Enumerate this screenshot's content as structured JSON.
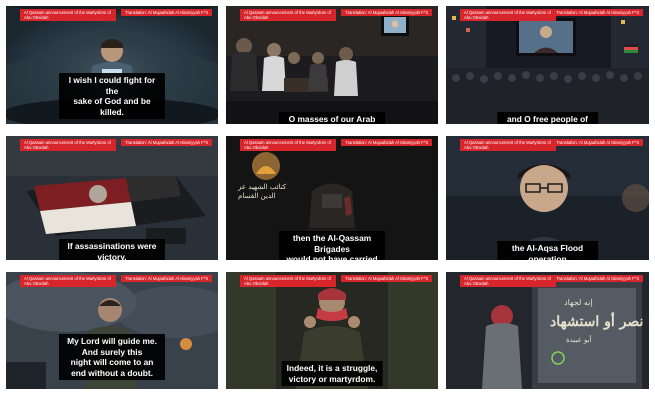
{
  "panels": [
    {
      "tag_left": "Al Qassam announcement of the Martyrdom of Abu Obeidah",
      "tag_right": "Translation: Al Mujaahidah Al Islamiyyah F^3",
      "caption": "I wish I could fight for the\nsake of God and be killed."
    },
    {
      "tag_left": "Al Qassam announcement of the Martyrdom of Abu Obeidah",
      "tag_right": "Translation: Al Mujaahidah Al Islamiyyah F^3",
      "caption": "O masses of our Arab and Islamic nation,"
    },
    {
      "tag_left": "Al Qassam announcement of the Martyrdom of Abu Obeidah",
      "tag_right": "Translation: Al Mujaahidah Al Islamiyyah F^3",
      "caption": "and O free people of the world everywhere,"
    },
    {
      "tag_left": "Al Qassam announcement of the Martyrdom of Abu Obeidah",
      "tag_right": "Translation: Al Mujaahidah Al Islamiyyah F^3",
      "caption": "If assassinations were victory,"
    },
    {
      "tag_left": "Al Qassam announcement of the Martyrdom of Abu Obeidah",
      "tag_right": "Translation: Al Mujaahidah Al Islamiyyah F^3",
      "caption": "then the Al-Qassam Brigades\nwould not have carried out",
      "logo_text": "كتائب الشهيد عز الدين القسام"
    },
    {
      "tag_left": "Al Qassam announcement of the Martyrdom of Abu Obeidah",
      "tag_right": "Translation: Al Mujaahidah Al Islamiyyah F^3",
      "caption": "the Al-Aqsa Flood operation"
    },
    {
      "tag_left": "Al Qassam announcement of the Martyrdom of Abu Obeidah",
      "tag_right": "Translation: Al Mujaahidah Al Islamiyyah F^3",
      "caption": "My Lord will guide me. And surely this\nnight will come to an end without a doubt."
    },
    {
      "tag_left": "Al Qassam announcement of the Martyrdom of Abu Obeidah",
      "tag_right": "Translation: Al Mujaahidah Al Islamiyyah F^3",
      "caption": "Indeed, it is a struggle,\nvictory or martyrdom."
    },
    {
      "tag_left": "Al Qassam announcement of the Martyrdom of Abu Obeidah",
      "tag_right": "Translation: Al Mujaahidah Al Islamiyyah F^3",
      "calligraphy_top": "إنه لجهاد",
      "calligraphy_main": "نصر أو استشهاد",
      "calligraphy_sub": "أبو عبيدة"
    }
  ]
}
